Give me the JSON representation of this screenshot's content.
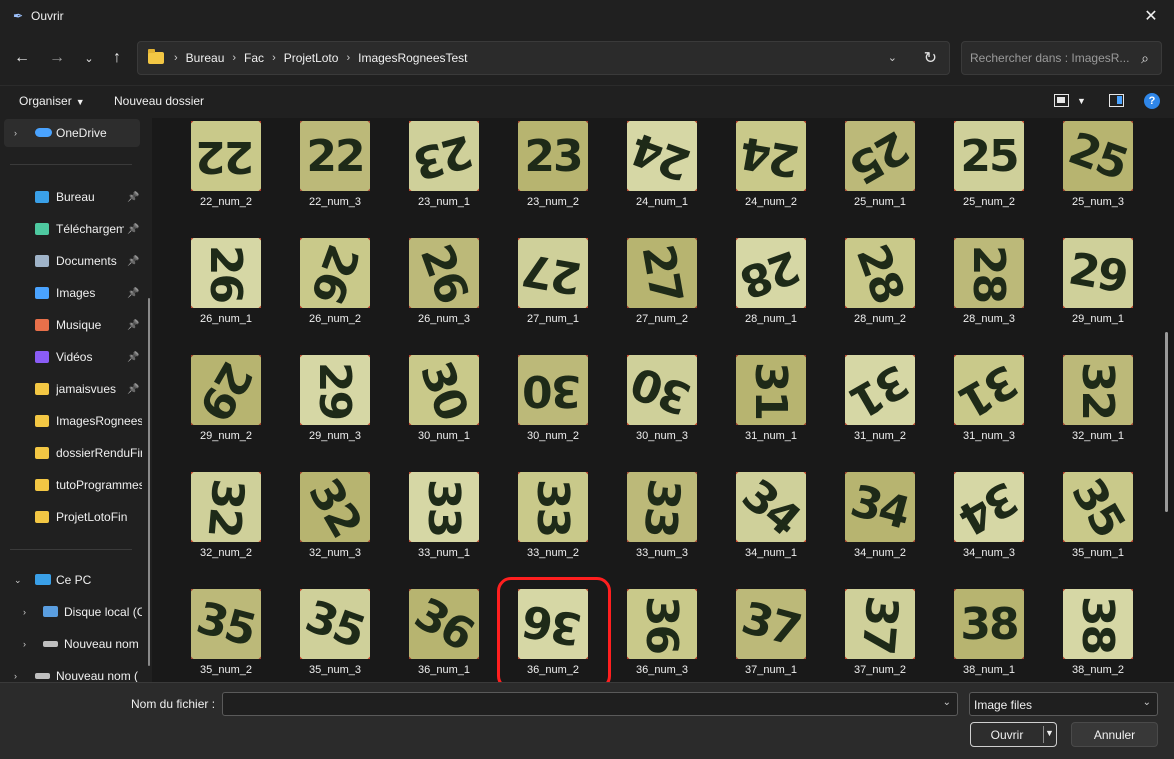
{
  "window": {
    "title": "Ouvrir"
  },
  "nav": {
    "breadcrumbs": [
      "Bureau",
      "Fac",
      "ProjetLoto",
      "ImagesRogneesTest"
    ],
    "search_placeholder": "Rechercher dans : ImagesR..."
  },
  "commands": {
    "organize": "Organiser",
    "new_folder": "Nouveau dossier"
  },
  "sidebar": {
    "onedrive": "OneDrive",
    "quick_access": [
      {
        "label": "Bureau",
        "icon": "desktop-icon",
        "pinned": true
      },
      {
        "label": "Téléchargements",
        "icon": "download-icon",
        "pinned": true
      },
      {
        "label": "Documents",
        "icon": "documents-icon",
        "pinned": true
      },
      {
        "label": "Images",
        "icon": "images-icon",
        "pinned": true
      },
      {
        "label": "Musique",
        "icon": "music-icon",
        "pinned": true
      },
      {
        "label": "Vidéos",
        "icon": "videos-icon",
        "pinned": true
      },
      {
        "label": "jamaisvues",
        "icon": "folder-icon",
        "pinned": true
      },
      {
        "label": "ImagesRogneesTest",
        "icon": "folder-icon",
        "pinned": false
      },
      {
        "label": "dossierRenduFinal",
        "icon": "folder-icon",
        "pinned": false
      },
      {
        "label": "tutoProgrammes",
        "icon": "folder-icon",
        "pinned": false
      },
      {
        "label": "ProjetLotoFin",
        "icon": "folder-icon",
        "pinned": false
      }
    ],
    "this_pc": "Ce PC",
    "drives": [
      "Disque local (C:)",
      "Nouveau nom",
      "Nouveau nom ("
    ]
  },
  "files": [
    {
      "name": "22_num_2",
      "digits": "22"
    },
    {
      "name": "22_num_3",
      "digits": "22"
    },
    {
      "name": "23_num_1",
      "digits": "23"
    },
    {
      "name": "23_num_2",
      "digits": "23"
    },
    {
      "name": "24_num_1",
      "digits": "24"
    },
    {
      "name": "24_num_2",
      "digits": "24"
    },
    {
      "name": "25_num_1",
      "digits": "25"
    },
    {
      "name": "25_num_2",
      "digits": "25"
    },
    {
      "name": "25_num_3",
      "digits": "25"
    },
    {
      "name": "26_num_1",
      "digits": "26"
    },
    {
      "name": "26_num_2",
      "digits": "26"
    },
    {
      "name": "26_num_3",
      "digits": "26"
    },
    {
      "name": "27_num_1",
      "digits": "27"
    },
    {
      "name": "27_num_2",
      "digits": "27"
    },
    {
      "name": "28_num_1",
      "digits": "28"
    },
    {
      "name": "28_num_2",
      "digits": "28"
    },
    {
      "name": "28_num_3",
      "digits": "28"
    },
    {
      "name": "29_num_1",
      "digits": "29"
    },
    {
      "name": "29_num_2",
      "digits": "29"
    },
    {
      "name": "29_num_3",
      "digits": "29"
    },
    {
      "name": "30_num_1",
      "digits": "30"
    },
    {
      "name": "30_num_2",
      "digits": "30"
    },
    {
      "name": "30_num_3",
      "digits": "30"
    },
    {
      "name": "31_num_1",
      "digits": "31"
    },
    {
      "name": "31_num_2",
      "digits": "31"
    },
    {
      "name": "31_num_3",
      "digits": "31"
    },
    {
      "name": "32_num_1",
      "digits": "32"
    },
    {
      "name": "32_num_2",
      "digits": "32"
    },
    {
      "name": "32_num_3",
      "digits": "32"
    },
    {
      "name": "33_num_1",
      "digits": "33"
    },
    {
      "name": "33_num_2",
      "digits": "33"
    },
    {
      "name": "33_num_3",
      "digits": "33"
    },
    {
      "name": "34_num_1",
      "digits": "34"
    },
    {
      "name": "34_num_2",
      "digits": "34"
    },
    {
      "name": "34_num_3",
      "digits": "34"
    },
    {
      "name": "35_num_1",
      "digits": "35"
    },
    {
      "name": "35_num_2",
      "digits": "35"
    },
    {
      "name": "35_num_3",
      "digits": "35"
    },
    {
      "name": "36_num_1",
      "digits": "36"
    },
    {
      "name": "36_num_2",
      "digits": "36",
      "highlighted": true
    },
    {
      "name": "36_num_3",
      "digits": "36"
    },
    {
      "name": "37_num_1",
      "digits": "37"
    },
    {
      "name": "37_num_2",
      "digits": "37"
    },
    {
      "name": "38_num_1",
      "digits": "38"
    },
    {
      "name": "38_num_2",
      "digits": "38"
    }
  ],
  "footer": {
    "filename_label": "Nom du fichier :",
    "filename_value": "",
    "filetype": "Image files",
    "open_label": "Ouvrir",
    "cancel_label": "Annuler"
  },
  "colors": {
    "highlight_ring": "#ff1f1f",
    "accent": "#2f86e8",
    "folder": "#f3c744"
  }
}
